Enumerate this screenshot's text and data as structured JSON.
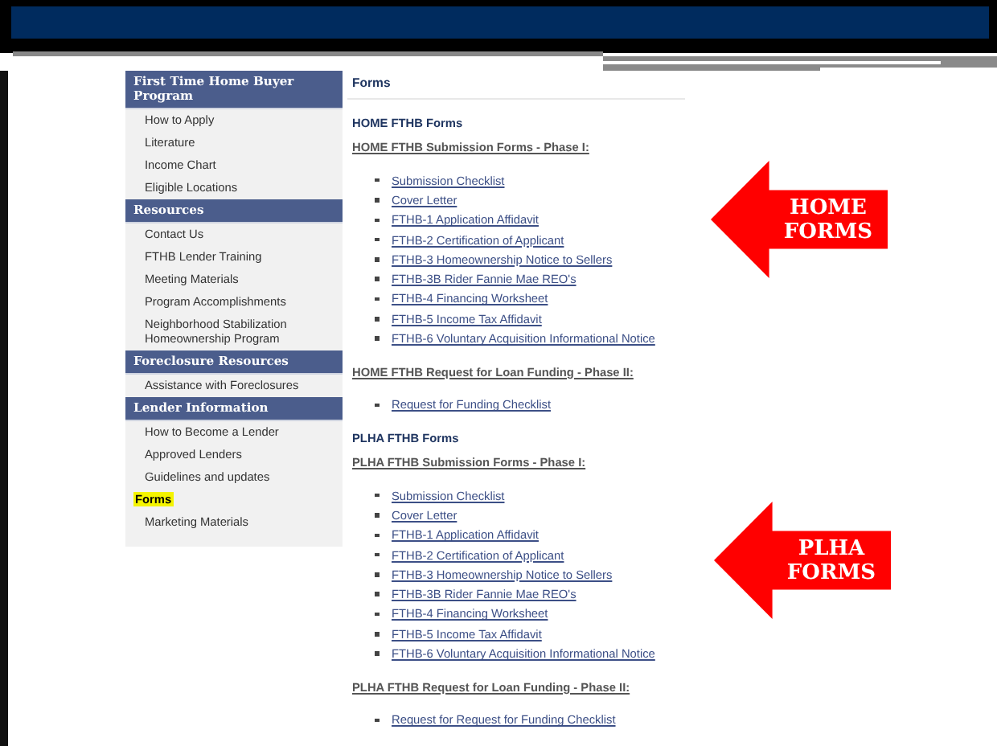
{
  "sidebar": {
    "sections": [
      {
        "title": "First Time Home Buyer Program",
        "items": [
          {
            "label": "How to Apply",
            "selected": false
          },
          {
            "label": "Literature",
            "selected": false
          },
          {
            "label": "Income Chart",
            "selected": false
          },
          {
            "label": "Eligible Locations",
            "selected": false
          }
        ]
      },
      {
        "title": "Resources",
        "items": [
          {
            "label": "Contact Us",
            "selected": false
          },
          {
            "label": "FTHB Lender Training",
            "selected": false
          },
          {
            "label": "Meeting Materials",
            "selected": false
          },
          {
            "label": "Program Accomplishments",
            "selected": false
          },
          {
            "label": "Neighborhood Stabilization Homeownership Program",
            "selected": false
          }
        ]
      },
      {
        "title": "Foreclosure Resources",
        "items": [
          {
            "label": "Assistance with Foreclosures",
            "selected": false
          }
        ]
      },
      {
        "title": "Lender Information",
        "items": [
          {
            "label": "How to Become a Lender",
            "selected": false
          },
          {
            "label": "Approved Lenders",
            "selected": false
          },
          {
            "label": "Guidelines and updates",
            "selected": false
          },
          {
            "label": "Forms",
            "selected": true
          },
          {
            "label": "Marketing Materials",
            "selected": false
          }
        ]
      }
    ]
  },
  "content": {
    "title": "Forms",
    "groups": [
      {
        "title": "HOME FTHB Forms",
        "sections": [
          {
            "heading": "HOME FTHB Submission Forms - Phase I:",
            "links": [
              "Submission Checklist",
              "Cover Letter",
              "FTHB-1 Application Affidavit",
              "FTHB-2 Certification of Applicant",
              "FTHB-3 Homeownership Notice to Sellers",
              "FTHB-3B Rider Fannie Mae REO's",
              "FTHB-4 Financing Worksheet",
              "FTHB-5 Income Tax Affidavit",
              "FTHB-6 Voluntary Acquisition Informational Notice"
            ]
          },
          {
            "heading": "HOME FTHB Request for Loan Funding - Phase II:",
            "links": [
              "Request for Funding Checklist"
            ]
          }
        ]
      },
      {
        "title": "PLHA FTHB Forms",
        "sections": [
          {
            "heading": "PLHA FTHB Submission Forms - Phase I:",
            "links": [
              "Submission Checklist",
              "Cover Letter",
              "FTHB-1 Application Affidavit",
              "FTHB-2 Certification of Applicant",
              "FTHB-3 Homeownership Notice to Sellers",
              "FTHB-3B Rider Fannie Mae REO's",
              "FTHB-4 Financing Worksheet",
              "FTHB-5 Income Tax Affidavit",
              "FTHB-6 Voluntary Acquisition Informational Notice"
            ]
          },
          {
            "heading": "PLHA FTHB Request for Loan Funding - Phase II:",
            "links": [
              "Request for Request for Funding Checklist"
            ]
          }
        ]
      }
    ]
  },
  "callouts": [
    {
      "lines": [
        "HOME",
        "FORMS"
      ]
    },
    {
      "lines": [
        "PLHA",
        "FORMS"
      ]
    }
  ]
}
